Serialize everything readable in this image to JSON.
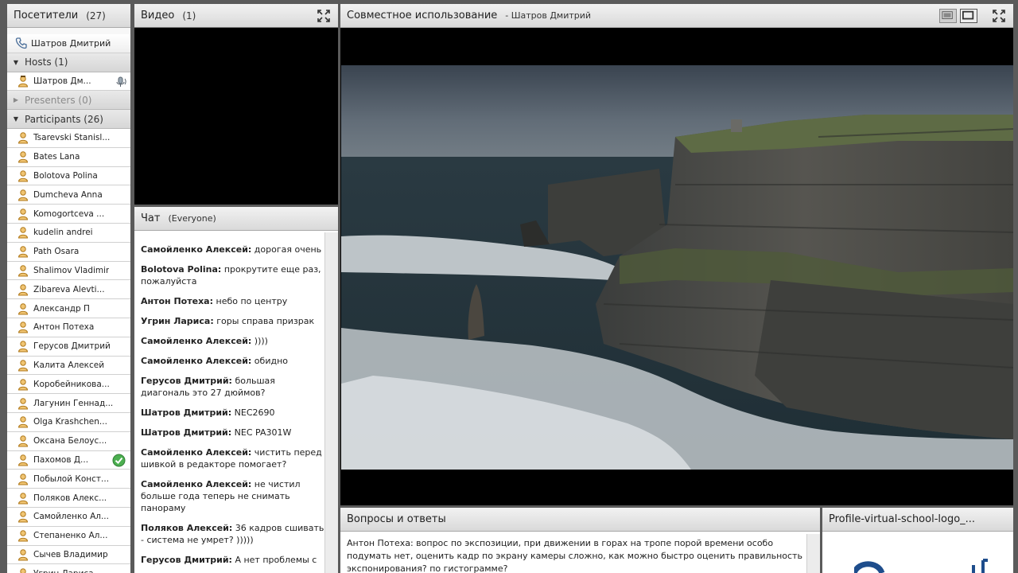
{
  "attendees": {
    "title": "Посетители",
    "count": "(27)",
    "me": "Шатров Дмитрий",
    "hosts_label": "Hosts (1)",
    "host": "Шатров Дм...",
    "presenters_label": "Presenters (0)",
    "participants_label": "Participants (26)",
    "participants": [
      "Tsarevski Stanisl...",
      "Bates Lana",
      "Bolotova Polina",
      "Dumcheva Anna",
      "Komogortceva ...",
      "kudelin andrei",
      "Path Osara",
      "Shalimov Vladimir",
      "Zibareva Alevti...",
      "Александр П",
      "Антон Потеха",
      "Герусов Дмитрий",
      "Калита Алексей",
      "Коробейникова...",
      "Лагунин Геннад...",
      "Olga Krashchen...",
      "Оксана Белоус...",
      "Пахомов Д...",
      "Побылой Конст...",
      "Поляков Алекс...",
      "Самойленко Ал...",
      "Степаненко Ал...",
      "Сычев Владимир",
      "Угрин Лариса"
    ]
  },
  "video": {
    "title": "Видео",
    "count": "(1)"
  },
  "chat": {
    "title": "Чат",
    "scope": "(Everyone)",
    "messages": [
      {
        "author": "Самойленко Алексей:",
        "text": " дорогая очень"
      },
      {
        "author": "Bolotova Polina:",
        "text": " прокрутите еще раз, пожалуйста"
      },
      {
        "author": "Антон Потеха:",
        "text": " небо по центру"
      },
      {
        "author": "Угрин Лариса:",
        "text": " горы справа призрак"
      },
      {
        "author": "Самойленко Алексей:",
        "text": " ))))"
      },
      {
        "author": "Самойленко Алексей:",
        "text": " обидно"
      },
      {
        "author": "Герусов Дмитрий:",
        "text": " большая диагональ это 27 дюймов?"
      },
      {
        "author": "Шатров Дмитрий:",
        "text": " NEC2690"
      },
      {
        "author": "Шатров Дмитрий:",
        "text": " NEC PA301W"
      },
      {
        "author": "Самойленко Алексей:",
        "text": " чистить перед шивкой в редакторе помогает?"
      },
      {
        "author": "Самойленко Алексей:",
        "text": " не чистил больше года теперь не снимать панораму"
      },
      {
        "author": "Поляков Алексей:",
        "text": " 36 кадров сшивать - система не умрет? )))))"
      },
      {
        "author": "Герусов Дмитрий:",
        "text": " А нет проблемы с"
      }
    ]
  },
  "share": {
    "title": "Совместное использование",
    "presenter": "- Шатров Дмитрий"
  },
  "qa": {
    "title": "Вопросы и ответы",
    "text": "Антон Потеха: вопрос по экспозиции, при движении в горах на тропе порой времени особо подумать нет, оценить кадр по экрану камеры сложно, как можно быстро оценить правильность экспонирования? по гистограмме?"
  },
  "logo_pod": {
    "title": "Profile-virtual-school-logo_..."
  },
  "colors": {
    "accent_online": "#4caf50",
    "person_icon": "#d99a2b"
  }
}
